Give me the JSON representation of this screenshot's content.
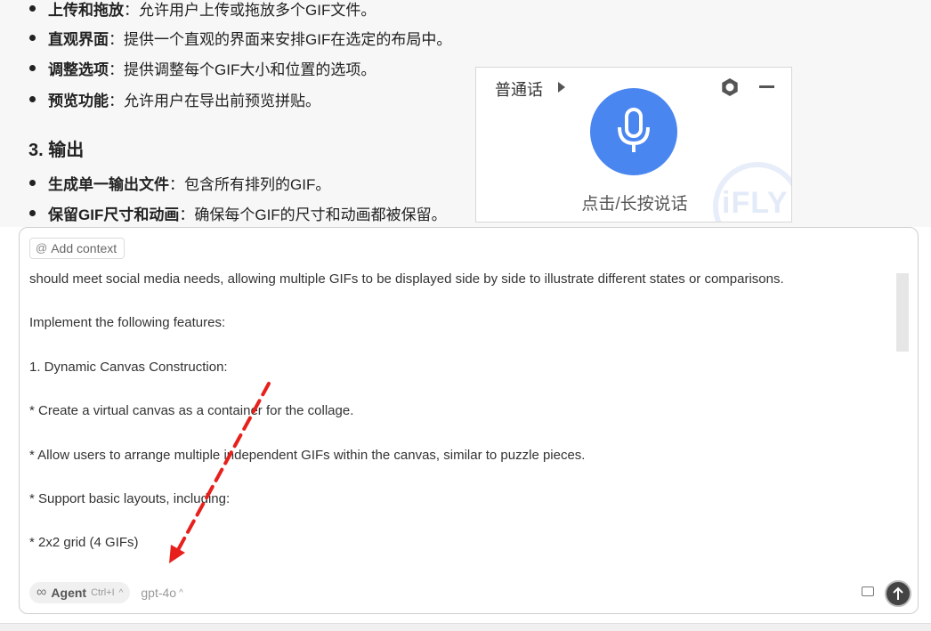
{
  "document": {
    "bullets": [
      {
        "bold": "上传和拖放",
        "text": "：允许用户上传或拖放多个GIF文件。"
      },
      {
        "bold": "直观界面",
        "text": "：提供一个直观的界面来安排GIF在选定的布局中。"
      },
      {
        "bold": "调整选项",
        "text": "：提供调整每个GIF大小和位置的选项。"
      },
      {
        "bold": "预览功能",
        "text": "：允许用户在导出前预览拼贴。"
      }
    ],
    "section_title": "3. 输出",
    "output_bullets": [
      {
        "bold": "生成单一输出文件",
        "text": "：包含所有排列的GIF。"
      },
      {
        "bold": "保留GIF尺寸和动画",
        "text": "：确保每个GIF的尺寸和动画都被保留。"
      }
    ]
  },
  "voice_widget": {
    "language": "普通话",
    "hint": "点击/长按说话",
    "watermark": "iFLY",
    "accent_color": "#4a86f0"
  },
  "chat": {
    "add_context_label": "Add context",
    "lines": [
      "should meet social media needs, allowing multiple GIFs to be displayed side by side to illustrate different states or comparisons.",
      "",
      "Implement the following features:",
      "",
      "1. Dynamic Canvas Construction:",
      "",
      "* Create a virtual canvas as a container for the collage.",
      "",
      "* Allow users to arrange multiple independent GIFs within the canvas, similar to puzzle pieces.",
      "",
      "* Support basic layouts, including:",
      "",
      "* 2x2 grid (4 GIFs)"
    ],
    "mode_label": "Agent",
    "mode_shortcut": "Ctrl+I",
    "model_label": "gpt-4o"
  },
  "annotation_color": "#e8201c"
}
